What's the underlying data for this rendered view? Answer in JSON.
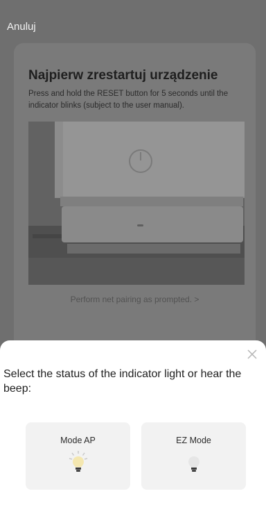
{
  "header": {
    "cancel_label": "Anuluj"
  },
  "card": {
    "title": "Najpierw zrestartuj urządzenie",
    "description": "Press and hold the RESET button for 5 seconds until the indicator blinks (subject to the user manual).",
    "pairing_link": "Perform net pairing as prompted. >"
  },
  "sheet": {
    "prompt": "Select the status of the indicator light or hear the beep:",
    "modes": [
      {
        "label": "Mode AP",
        "icon": "blinking-bulb-icon"
      },
      {
        "label": "EZ Mode",
        "icon": "bulb-icon"
      }
    ]
  }
}
